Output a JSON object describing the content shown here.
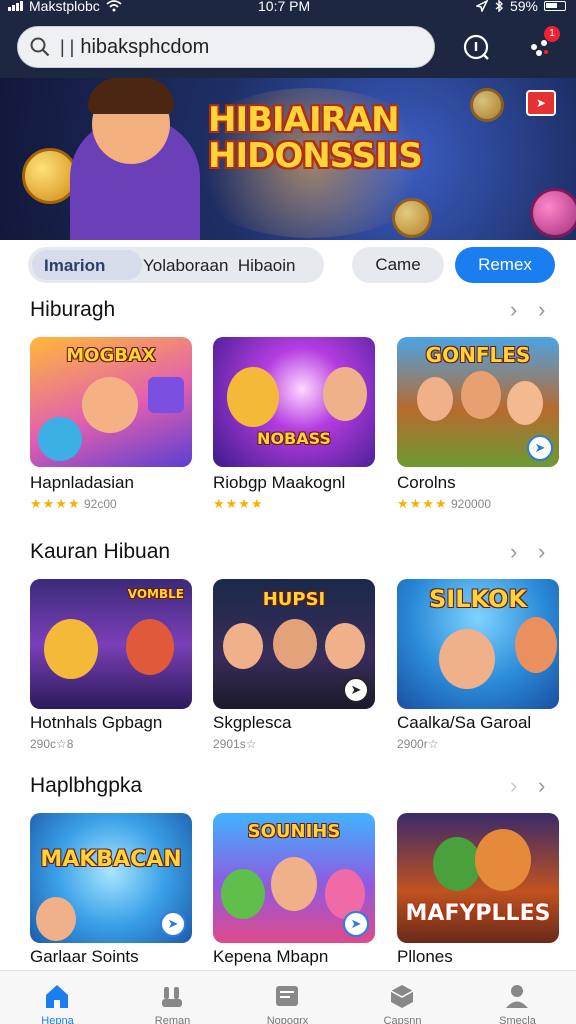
{
  "status_bar": {
    "carrier": "Makstplobc",
    "time": "10:7 PM",
    "battery": "59%"
  },
  "search": {
    "value": "hibaksphcdom"
  },
  "header": {
    "notification_badge": "1"
  },
  "banner": {
    "title_line1": "HIBIAIRAN",
    "title_line2": "HIDONSSIIS"
  },
  "filters": {
    "segment_active": "Imarion",
    "segment_other": "Yolaboraan  Hibaoin",
    "game": "Came",
    "remix": "Remex"
  },
  "sections": [
    {
      "title": "Hiburagh",
      "items": [
        {
          "name": "Hapnladasian",
          "sub": "92c00",
          "stars": "★★★★",
          "img_text": "MOGBAX"
        },
        {
          "name": "Riobgp Maakognl",
          "sub": "",
          "stars": "★★★★",
          "img_text": "NOBASS"
        },
        {
          "name": "Corolns",
          "sub": "920000",
          "stars": "★★★★",
          "img_text": "GONFLES"
        }
      ]
    },
    {
      "title": "Kauran Hibuan",
      "items": [
        {
          "name": "Hotnhals Gpbagn",
          "sub": "290c☆8",
          "stars": "",
          "img_text": "VOMBLE"
        },
        {
          "name": "Skgplesca",
          "sub": "2901s☆",
          "stars": "",
          "img_text": "HUPSI"
        },
        {
          "name": "Caalka/Sa Garoal",
          "sub": "2900r☆",
          "stars": "",
          "img_text": "SILKOK"
        }
      ]
    },
    {
      "title": "Haplbhgpka",
      "items": [
        {
          "name": "Garlaar Soints",
          "sub": "",
          "stars": "",
          "img_text": "MAKBACAN"
        },
        {
          "name": "Kepena Mbapn",
          "sub": "",
          "stars": "",
          "img_text": "SOUNIHS"
        },
        {
          "name": "Pllones",
          "sub": "",
          "stars": "",
          "img_text": "MAFYPLLES"
        }
      ]
    }
  ],
  "bottom_nav": [
    {
      "label": "Hepna",
      "icon": "home-icon"
    },
    {
      "label": "Reman",
      "icon": "people-icon"
    },
    {
      "label": "Nopogrx",
      "icon": "news-icon"
    },
    {
      "label": "Capsnn",
      "icon": "box-icon"
    },
    {
      "label": "Smecla",
      "icon": "person-icon"
    }
  ],
  "colors": {
    "header_bg": "#1d2742",
    "accent": "#1a7ef0",
    "star": "#f5b301"
  }
}
